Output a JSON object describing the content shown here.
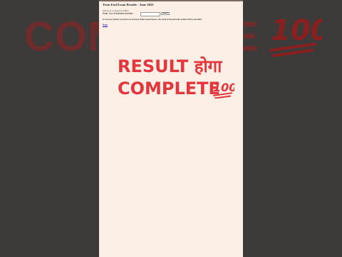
{
  "background": {
    "overlay_text": "COMPLETE",
    "emoji_icon": "hundred-points-icon"
  },
  "page": {
    "title": "Term End Exam Results - June 2023",
    "welcome": "Welcome to Regional Office",
    "enrollment_label": "Enter Your Enrolment Number :",
    "enrollment_value": "",
    "search_label": "Search",
    "notice": "In case any student is found to be involved unfair means/misuse, the result of the particular student will be cancelled",
    "back_link": "Back"
  },
  "headline": {
    "line1": "RESULT होगा",
    "line2": "COMPLETE"
  },
  "colors": {
    "headline": "#e4363d",
    "background": "#3d3b39",
    "page": "#fcf0e6"
  }
}
